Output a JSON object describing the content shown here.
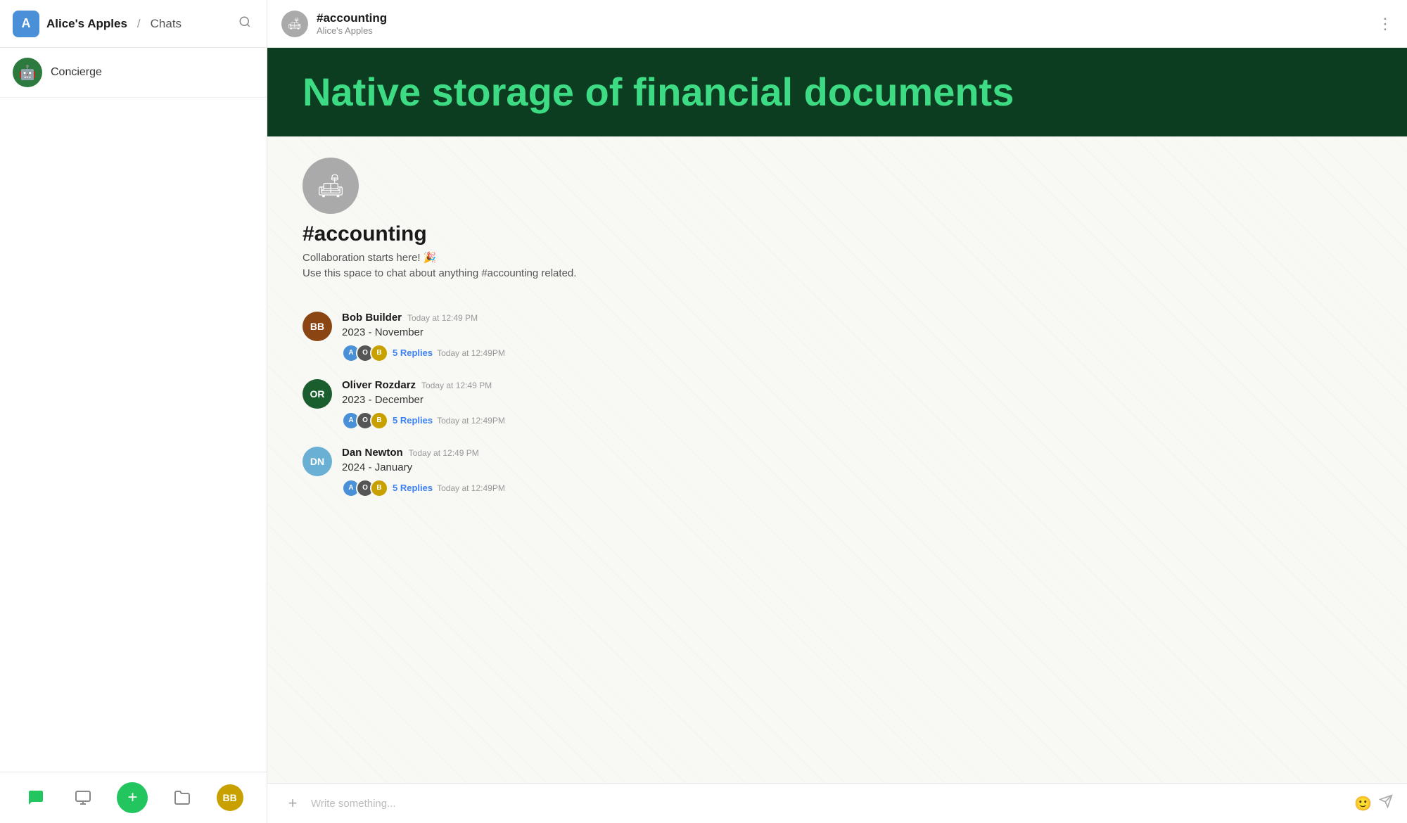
{
  "sidebar": {
    "workspace": "Alice's Apples",
    "section": "Chats",
    "workspace_initial": "A",
    "items": [
      {
        "id": "concierge",
        "label": "Concierge",
        "icon": "🤖"
      }
    ],
    "bottom_nav": [
      {
        "id": "chat",
        "icon": "💬",
        "active": true,
        "label": "Chat"
      },
      {
        "id": "camera",
        "icon": "🖥",
        "active": false,
        "label": "Screen"
      },
      {
        "id": "add",
        "icon": "+",
        "label": "Add"
      },
      {
        "id": "folder",
        "icon": "📁",
        "label": "Files"
      },
      {
        "id": "profile",
        "label": "Profile",
        "initials": "BB"
      }
    ]
  },
  "topbar": {
    "channel_name": "#accounting",
    "workspace_name": "Alice's Apples",
    "more_icon": "⋮"
  },
  "banner": {
    "text": "Native storage of financial documents"
  },
  "channel": {
    "big_icon": "🛋",
    "name": "#accounting",
    "description_line1": "Collaboration starts here! 🎉",
    "description_line2": "Use this space to chat about anything #accounting related."
  },
  "messages": [
    {
      "id": "msg1",
      "author": "Bob Builder",
      "time": "Today at 12:49 PM",
      "text": "2023 - November",
      "avatar_color": "#8b4513",
      "avatar_initials": "BB",
      "replies": {
        "count": "5 Replies",
        "time": "Today at 12:49PM",
        "avatars": [
          {
            "color": "#4a90d9",
            "initials": "A"
          },
          {
            "color": "#555",
            "initials": "O"
          },
          {
            "color": "#c8a000",
            "initials": "B"
          }
        ]
      }
    },
    {
      "id": "msg2",
      "author": "Oliver Rozdarz",
      "time": "Today at 12:49 PM",
      "text": "2023 - December",
      "avatar_color": "#1a5e2e",
      "avatar_initials": "OR",
      "replies": {
        "count": "5 Replies",
        "time": "Today at 12:49PM",
        "avatars": [
          {
            "color": "#4a90d9",
            "initials": "A"
          },
          {
            "color": "#555",
            "initials": "O"
          },
          {
            "color": "#c8a000",
            "initials": "B"
          }
        ]
      }
    },
    {
      "id": "msg3",
      "author": "Dan Newton",
      "time": "Today at 12:49 PM",
      "text": "2024 - January",
      "avatar_color": "#6ab0d4",
      "avatar_initials": "DN",
      "replies": {
        "count": "5 Replies",
        "time": "Today at 12:49PM",
        "avatars": [
          {
            "color": "#4a90d9",
            "initials": "A"
          },
          {
            "color": "#555",
            "initials": "O"
          },
          {
            "color": "#c8a000",
            "initials": "B"
          }
        ]
      }
    }
  ],
  "input": {
    "placeholder": "Write something...",
    "add_icon": "+",
    "emoji_icon": "😊",
    "send_icon": "➤"
  }
}
